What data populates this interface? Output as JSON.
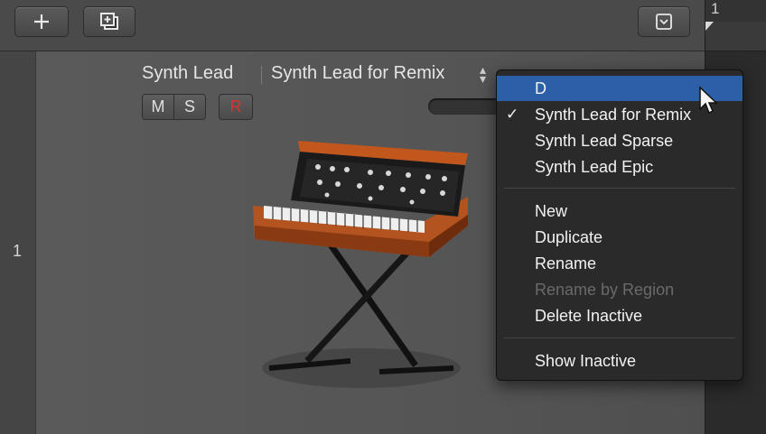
{
  "toolbar": {
    "add_button_icon": "plus-icon",
    "duplicate_button_icon": "duplicate-track-icon",
    "collapse_button_icon": "collapse-icon"
  },
  "ruler": {
    "bar_number": "1"
  },
  "track": {
    "number": "1",
    "name": "Synth Lead",
    "patch_name": "Synth Lead for Remix",
    "mute_label": "M",
    "solo_label": "S",
    "record_label": "R",
    "record_color": "#e0312b",
    "instrument_icon": "synth-keyboard-icon"
  },
  "patch_menu": {
    "highlight_color": "#2b5fa8",
    "items": [
      {
        "label": "D",
        "checked": false,
        "highlighted": true,
        "disabled": false
      },
      {
        "label": "Synth Lead for Remix",
        "checked": true,
        "highlighted": false,
        "disabled": false
      },
      {
        "label": "Synth Lead Sparse",
        "checked": false,
        "highlighted": false,
        "disabled": false
      },
      {
        "label": "Synth Lead Epic",
        "checked": false,
        "highlighted": false,
        "disabled": false
      },
      {
        "label": "New",
        "checked": false,
        "highlighted": false,
        "disabled": false
      },
      {
        "label": "Duplicate",
        "checked": false,
        "highlighted": false,
        "disabled": false
      },
      {
        "label": "Rename",
        "checked": false,
        "highlighted": false,
        "disabled": false
      },
      {
        "label": "Rename by Region",
        "checked": false,
        "highlighted": false,
        "disabled": true
      },
      {
        "label": "Delete Inactive",
        "checked": false,
        "highlighted": false,
        "disabled": false
      },
      {
        "label": "Show Inactive",
        "checked": false,
        "highlighted": false,
        "disabled": false
      }
    ],
    "check_glyph": "✓"
  }
}
